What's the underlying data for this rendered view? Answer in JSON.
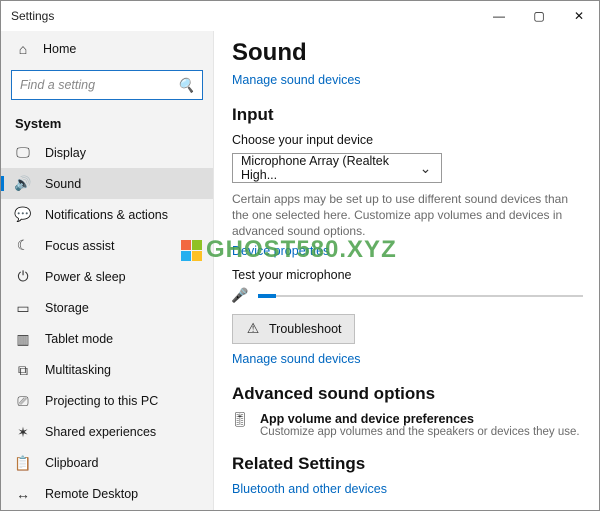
{
  "window": {
    "title": "Settings"
  },
  "winctl": {
    "min": "—",
    "max": "▢",
    "close": "✕"
  },
  "sidebar": {
    "home": "Home",
    "search_placeholder": "Find a setting",
    "header": "System",
    "items": [
      {
        "label": "Display"
      },
      {
        "label": "Sound"
      },
      {
        "label": "Notifications & actions"
      },
      {
        "label": "Focus assist"
      },
      {
        "label": "Power & sleep"
      },
      {
        "label": "Storage"
      },
      {
        "label": "Tablet mode"
      },
      {
        "label": "Multitasking"
      },
      {
        "label": "Projecting to this PC"
      },
      {
        "label": "Shared experiences"
      },
      {
        "label": "Clipboard"
      },
      {
        "label": "Remote Desktop"
      }
    ]
  },
  "main": {
    "page_title": "Sound",
    "manage_link_top": "Manage sound devices",
    "input_header": "Input",
    "choose_label": "Choose your input device",
    "input_device": "Microphone Array (Realtek High...",
    "note": "Certain apps may be set up to use different sound devices than the one selected here. Customize app volumes and devices in advanced sound options.",
    "device_props_link": "Device properties",
    "test_label": "Test your microphone",
    "troubleshoot": "Troubleshoot",
    "manage_link_bottom": "Manage sound devices",
    "advanced_header": "Advanced sound options",
    "adv_item_title": "App volume and device preferences",
    "adv_item_sub": "Customize app volumes and the speakers or devices they use.",
    "related_header": "Related Settings",
    "related_link": "Bluetooth and other devices"
  },
  "watermark": "GHOST580.XYZ"
}
